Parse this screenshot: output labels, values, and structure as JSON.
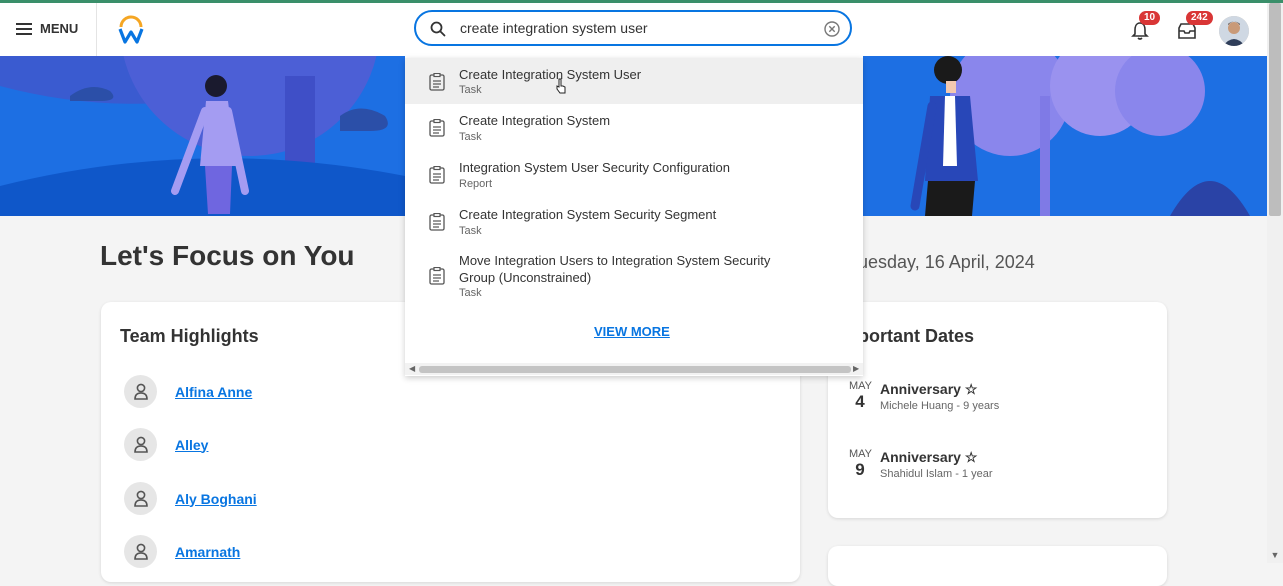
{
  "header": {
    "menu_label": "MENU",
    "notifications_count": "10",
    "inbox_count": "242"
  },
  "search": {
    "value": "create integration system user",
    "results": [
      {
        "title": "Create Integration System User",
        "type": "Task"
      },
      {
        "title": "Create Integration System",
        "type": "Task"
      },
      {
        "title": "Integration System User Security Configuration",
        "type": "Report"
      },
      {
        "title": "Create Integration System Security Segment",
        "type": "Task"
      },
      {
        "title": "Move Integration Users to Integration System Security Group (Unconstrained)",
        "type": "Task"
      }
    ],
    "view_more": "VIEW MORE"
  },
  "main": {
    "title": "Let's Focus on You",
    "date": "uesday, 16 April, 2024"
  },
  "team_highlights": {
    "title": "Team Highlights",
    "people": [
      "Alfina Anne",
      "Alley",
      "Aly Boghani",
      "Amarnath"
    ]
  },
  "important_dates": {
    "title": "portant Dates",
    "items": [
      {
        "month": "MAY",
        "day": "4",
        "event": "Anniversary",
        "detail": "Michele Huang - 9 years"
      },
      {
        "month": "MAY",
        "day": "9",
        "event": "Anniversary",
        "detail": "Shahidul Islam - 1 year"
      }
    ]
  },
  "colors": {
    "accent": "#0875e1",
    "hero": "#1e6fe0",
    "badge": "#d93636"
  }
}
